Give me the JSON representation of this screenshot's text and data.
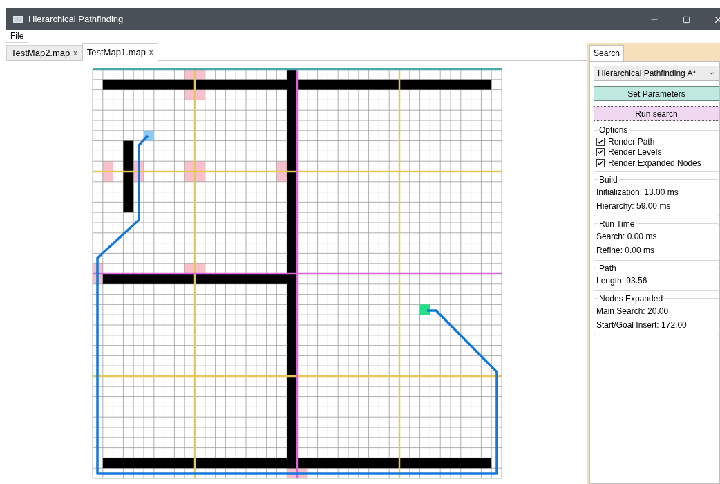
{
  "window": {
    "title": "Hierarchical Pathfinding"
  },
  "menu": [
    "File"
  ],
  "tabs": [
    {
      "label": "TestMap2.map",
      "close": "x",
      "selected": false
    },
    {
      "label": "TestMap1.map",
      "close": "x",
      "selected": true
    }
  ],
  "sidebar": {
    "tabs": [
      {
        "label": "Search",
        "selected": true
      }
    ],
    "algorithm": {
      "value": "Hierarchical Pathfinding A*"
    },
    "buttons": [
      {
        "label": "Set Parameters",
        "kind": "primary"
      },
      {
        "label": "Run search",
        "kind": "focused"
      }
    ],
    "options": {
      "title": "Options",
      "items": [
        {
          "label": "Render Path",
          "checked": true
        },
        {
          "label": "Render Levels",
          "checked": true
        },
        {
          "label": "Render Expanded Nodes",
          "checked": true
        }
      ]
    },
    "groups": [
      {
        "title": "Build",
        "lines": [
          "Initialization: 13.00 ms",
          "Hierarchy: 59.00 ms"
        ]
      },
      {
        "title": "Run Time",
        "lines": [
          "Search: 0.00 ms",
          "Refine: 0.00 ms"
        ]
      },
      {
        "title": "Path",
        "lines": [
          "Length: 93.56"
        ]
      },
      {
        "title": "Nodes Expanded",
        "lines": [
          "Main Search: 20.00",
          "Start/Goal Insert: 172.00"
        ]
      }
    ]
  }
}
